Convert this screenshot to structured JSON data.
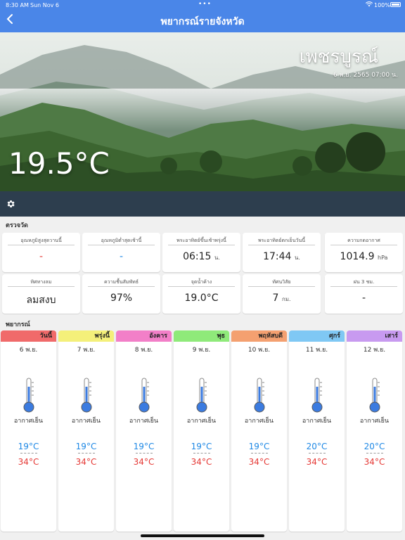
{
  "status_bar": {
    "time": "8:30 AM",
    "date": "Sun Nov 6",
    "battery": "100%"
  },
  "nav": {
    "title": "พยากรณ์รายจังหวัด",
    "back_icon": "chevron-left-icon"
  },
  "hero": {
    "province": "เพชรบูรณ์",
    "observed_at": "6 พ.ย. 2565 07:00 น.",
    "temperature": "19.5°C"
  },
  "settings_icon": "gear-icon",
  "observation": {
    "section_title": "ตรวจวัด",
    "row1": [
      {
        "label": "อุณหภูมิสูงสุดวานนี้",
        "value": "-",
        "unit": ""
      },
      {
        "label": "อุณหภูมิต่ำสุดเช้านี้",
        "value": "-",
        "unit": ""
      },
      {
        "label": "พระอาทิตย์ขึ้นเช้าพรุ่งนี้",
        "value": "06:15",
        "unit": "น."
      },
      {
        "label": "พระอาทิตย์ตกเย็นวันนี้",
        "value": "17:44",
        "unit": "น."
      },
      {
        "label": "ความกดอากาศ",
        "value": "1014.9",
        "unit": "hPa"
      }
    ],
    "row2": [
      {
        "label": "ทิศทางลม",
        "value": "ลมสงบ",
        "unit": ""
      },
      {
        "label": "ความชื้นสัมพัทธ์",
        "value": "97%",
        "unit": ""
      },
      {
        "label": "จุดน้ำค้าง",
        "value": "19.0°C",
        "unit": ""
      },
      {
        "label": "ทัศนวิสัย",
        "value": "7",
        "unit": "กม."
      },
      {
        "label": "ฝน 3 ชม.",
        "value": "-",
        "unit": ""
      }
    ]
  },
  "forecast": {
    "section_title": "พยากรณ์",
    "days": [
      {
        "name": "วันนี้",
        "date": "6 พ.ย.",
        "desc": "อากาศเย็น",
        "low": "19°C",
        "high": "34°C",
        "color": "#f06a6a"
      },
      {
        "name": "พรุ่งนี้",
        "date": "7 พ.ย.",
        "desc": "อากาศเย็น",
        "low": "19°C",
        "high": "34°C",
        "color": "#f4f07a"
      },
      {
        "name": "อังคาร",
        "date": "8 พ.ย.",
        "desc": "อากาศเย็น",
        "low": "19°C",
        "high": "34°C",
        "color": "#f27fc8"
      },
      {
        "name": "พุธ",
        "date": "9 พ.ย.",
        "desc": "อากาศเย็น",
        "low": "19°C",
        "high": "34°C",
        "color": "#8fea7a"
      },
      {
        "name": "พฤหัสบดี",
        "date": "10 พ.ย.",
        "desc": "อากาศเย็น",
        "low": "19°C",
        "high": "34°C",
        "color": "#f4a070"
      },
      {
        "name": "ศุกร์",
        "date": "11 พ.ย.",
        "desc": "อากาศเย็น",
        "low": "20°C",
        "high": "34°C",
        "color": "#7fc8f4"
      },
      {
        "name": "เสาร์",
        "date": "12 พ.ย.",
        "desc": "อากาศเย็น",
        "low": "20°C",
        "high": "34°C",
        "color": "#c89af0"
      }
    ]
  }
}
